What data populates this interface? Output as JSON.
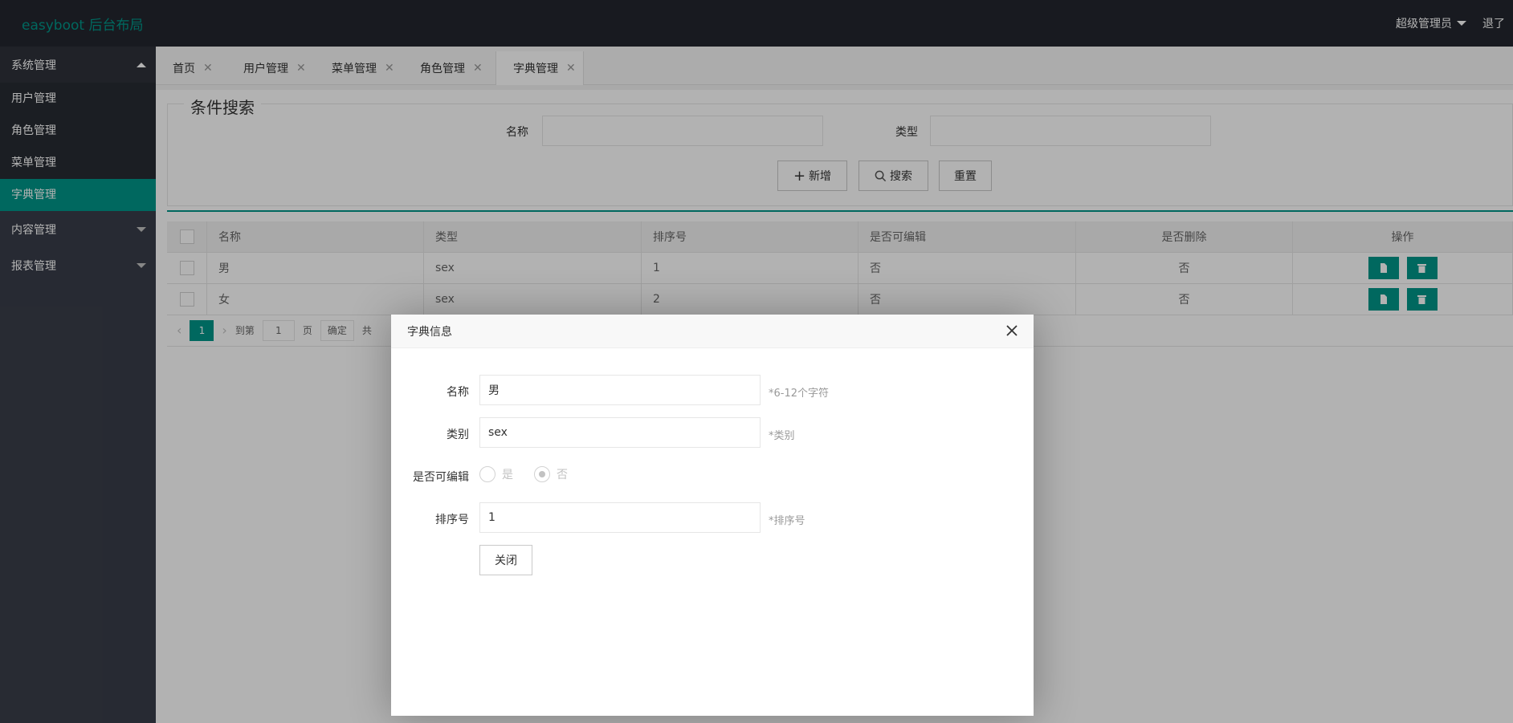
{
  "header": {
    "logo": "easyboot 后台布局",
    "user": "超级管理员",
    "logout": "退了"
  },
  "sidebar": {
    "group_system": "系统管理",
    "items": [
      "用户管理",
      "角色管理",
      "菜单管理",
      "字典管理"
    ],
    "group_content": "内容管理",
    "group_report": "报表管理"
  },
  "tabs": [
    "首页",
    "用户管理",
    "菜单管理",
    "角色管理",
    "字典管理"
  ],
  "search": {
    "legend": "条件搜索",
    "name_label": "名称",
    "type_label": "类型",
    "add_label": "新增",
    "search_label": "搜索",
    "reset_label": "重置"
  },
  "table": {
    "headers": [
      "名称",
      "类型",
      "排序号",
      "是否可编辑",
      "是否删除",
      "操作"
    ],
    "rows": [
      [
        "男",
        "sex",
        "1",
        "否",
        "否"
      ],
      [
        "女",
        "sex",
        "2",
        "否",
        "否"
      ]
    ]
  },
  "pager": {
    "current": "1",
    "goto": "到第",
    "page_value": "1",
    "page_unit": "页",
    "confirm": "确定",
    "total_prefix": "共"
  },
  "dialog": {
    "title": "字典信息",
    "name_label": "名称",
    "name_value": "男",
    "name_hint": "*6-12个字符",
    "type_label": "类别",
    "type_value": "sex",
    "type_hint": "*类别",
    "editable_label": "是否可编辑",
    "opt_yes": "是",
    "opt_no": "否",
    "order_label": "排序号",
    "order_value": "1",
    "order_hint": "*排序号",
    "close_label": "关闭"
  },
  "colors": {
    "accent": "#009688",
    "header_bg": "#23262e",
    "sidebar_bg": "#393d49"
  }
}
